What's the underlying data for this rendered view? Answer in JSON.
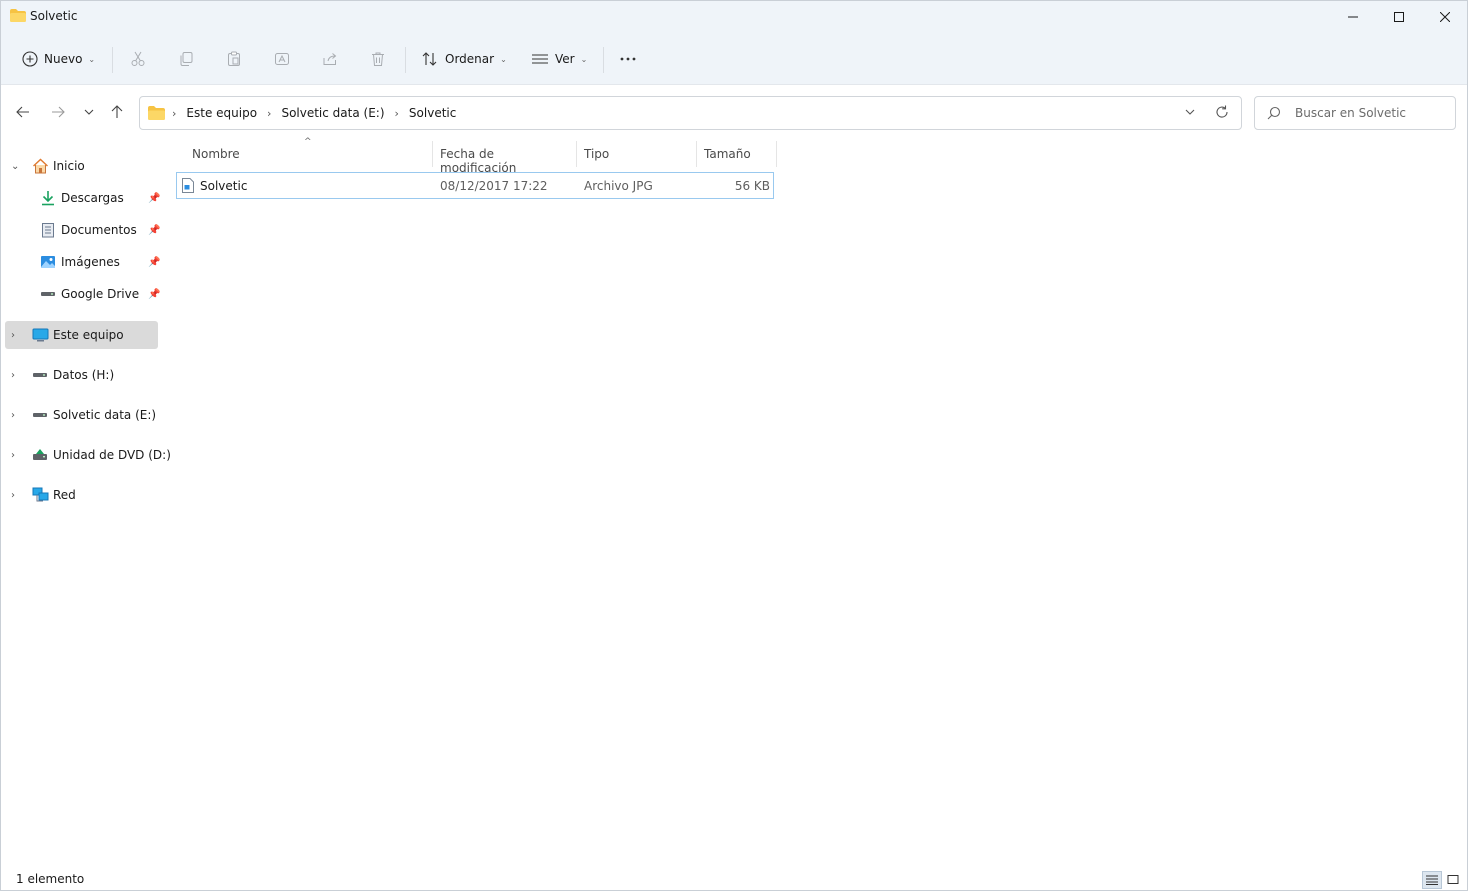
{
  "window": {
    "title": "Solvetic",
    "colors": {
      "chrome": "#eff4f9",
      "selection_border": "#99c9ef",
      "selected_nav": "#dadada",
      "folder": "#f6c343"
    }
  },
  "toolbar": {
    "new_label": "Nuevo",
    "sort_label": "Ordenar",
    "view_label": "Ver",
    "icons": [
      "add-icon",
      "cut-icon",
      "copy-icon",
      "paste-icon",
      "rename-icon",
      "share-icon",
      "delete-icon",
      "sort-icon",
      "view-icon",
      "more-icon"
    ]
  },
  "address": {
    "crumbs": [
      "Este equipo",
      "Solvetic data (E:)",
      "Solvetic"
    ]
  },
  "search": {
    "placeholder": "Buscar en Solvetic"
  },
  "sidebar": {
    "items": [
      {
        "label": "Inicio",
        "icon": "home-icon"
      },
      {
        "label": "Descargas",
        "icon": "download-icon",
        "pinned": true
      },
      {
        "label": "Documentos",
        "icon": "documents-icon",
        "pinned": true
      },
      {
        "label": "Imágenes",
        "icon": "pictures-icon",
        "pinned": true
      },
      {
        "label": "Google Drive (G:)",
        "icon": "drive-icon",
        "pinned": true
      },
      {
        "label": "Este equipo",
        "icon": "computer-icon",
        "selected": true
      },
      {
        "label": "Datos (H:)",
        "icon": "drive-icon"
      },
      {
        "label": "Solvetic data (E:)",
        "icon": "drive-icon"
      },
      {
        "label": "Unidad de DVD (D:)",
        "icon": "dvd-icon"
      },
      {
        "label": "Red",
        "icon": "network-icon"
      }
    ]
  },
  "columns": [
    "Nombre",
    "Fecha de modificación",
    "Tipo",
    "Tamaño"
  ],
  "files": [
    {
      "name": "Solvetic",
      "modified": "08/12/2017 17:22",
      "type": "Archivo JPG",
      "size": "56 KB"
    }
  ],
  "status": {
    "count": "1 elemento"
  }
}
